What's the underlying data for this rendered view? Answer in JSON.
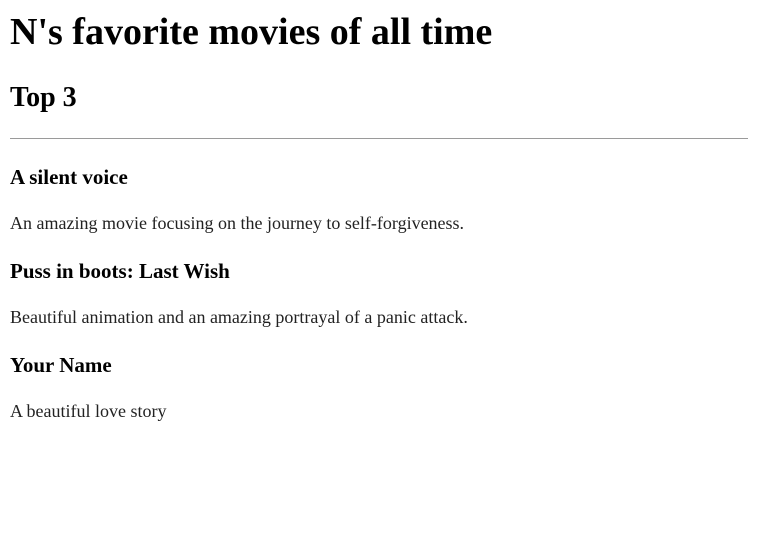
{
  "page": {
    "title": "N's favorite movies of all time",
    "subtitle": "Top 3"
  },
  "movies": [
    {
      "title": "A silent voice",
      "description": "An amazing movie focusing on the journey to self-forgiveness."
    },
    {
      "title": "Puss in boots: Last Wish",
      "description": "Beautiful animation and an amazing portrayal of a panic attack."
    },
    {
      "title": "Your Name",
      "description": "A beautiful love story"
    }
  ]
}
